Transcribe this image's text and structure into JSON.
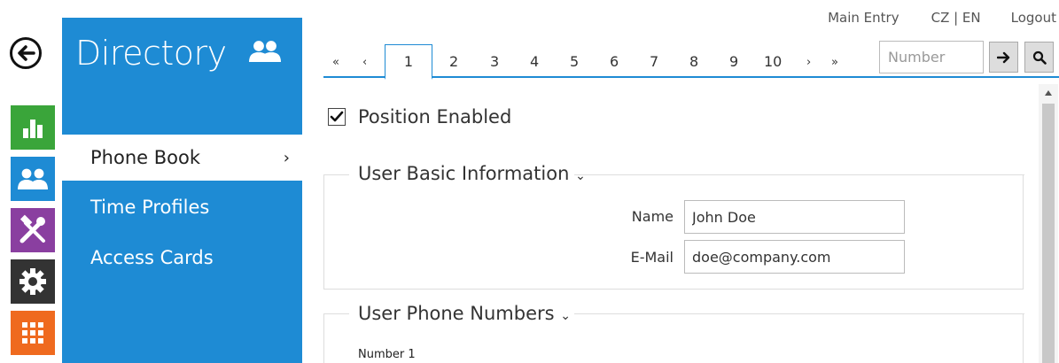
{
  "toplinks": {
    "main_entry": "Main Entry",
    "lang": "CZ | EN",
    "logout": "Logout"
  },
  "panel": {
    "title": "Directory",
    "items": [
      {
        "label": "Phone Book",
        "active": true
      },
      {
        "label": "Time Profiles",
        "active": false
      },
      {
        "label": "Access Cards",
        "active": false
      }
    ]
  },
  "rail": {
    "colors": {
      "stats": "#3aa53a",
      "directory": "#1e8bd4",
      "hardware": "#8a3fa0",
      "services": "#333333",
      "system": "#ef6a1f"
    }
  },
  "pager": {
    "first": "«",
    "prev": "‹",
    "pages": [
      "1",
      "2",
      "3",
      "4",
      "5",
      "6",
      "7",
      "8",
      "9",
      "10"
    ],
    "current": "1",
    "next": "›",
    "last": "»",
    "number_placeholder": "Number"
  },
  "content": {
    "position_enabled_label": "Position Enabled",
    "position_enabled": true,
    "basic_info": {
      "title": "User Basic Information",
      "name_label": "Name",
      "name_value": "John Doe",
      "email_label": "E-Mail",
      "email_value": "doe@company.com"
    },
    "phone_numbers": {
      "title": "User Phone Numbers",
      "number1_label": "Number 1"
    }
  },
  "accent_color": "#1e8bd4"
}
